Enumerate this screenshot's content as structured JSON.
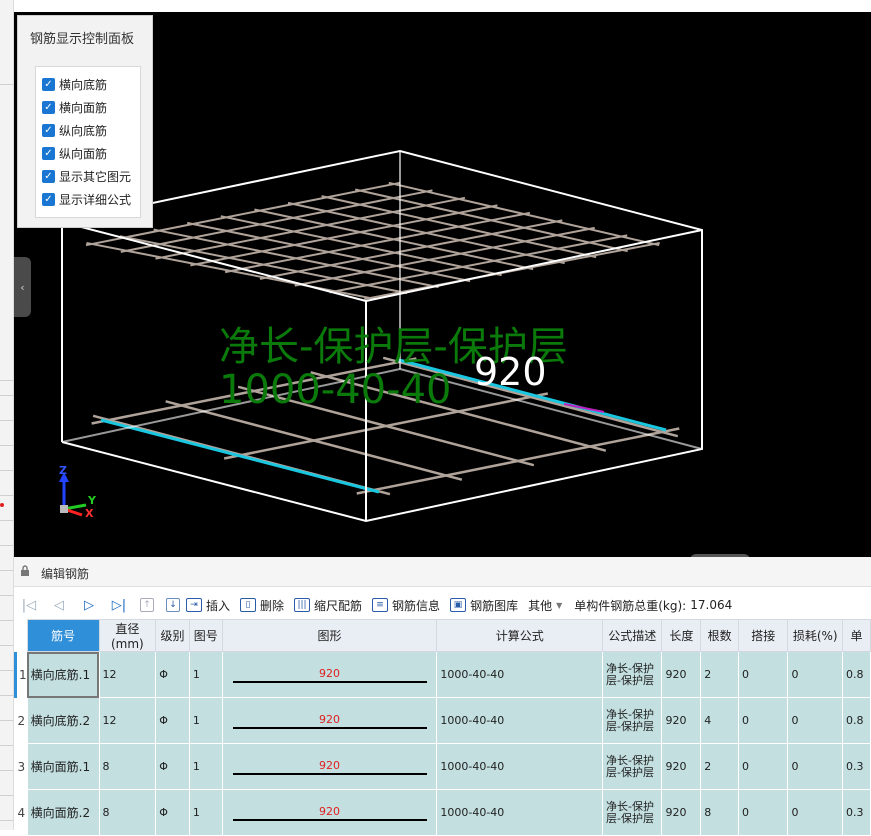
{
  "control_panel": {
    "title": "钢筋显示控制面板",
    "options": [
      {
        "label": "横向底筋",
        "checked": true
      },
      {
        "label": "横向面筋",
        "checked": true
      },
      {
        "label": "纵向底筋",
        "checked": true
      },
      {
        "label": "纵向面筋",
        "checked": true
      },
      {
        "label": "显示其它图元",
        "checked": true
      },
      {
        "label": "显示详细公式",
        "checked": true
      }
    ]
  },
  "viewport": {
    "formula_label": "净长-保护层-保护层",
    "formula_values": "1000-40-40",
    "length_label": "920",
    "axes": {
      "x": "X",
      "y": "Y",
      "z": "Z"
    },
    "colors": {
      "background": "#000000",
      "box_edges": "#ffffff",
      "rebar": "#b0a39a",
      "highlight": "#19c8e0",
      "formula": "#0a7a0a"
    }
  },
  "editor": {
    "title": "编辑钢筋",
    "toolbar": {
      "insert": "插入",
      "delete": "删除",
      "scale_rebar": "缩尺配筋",
      "rebar_info": "钢筋信息",
      "rebar_library": "钢筋图库",
      "other": "其他",
      "total_weight_label": "单构件钢筋总重(kg):",
      "total_weight_value": "17.064"
    },
    "columns": [
      "筋号",
      "直径(mm)",
      "级别",
      "图号",
      "图形",
      "计算公式",
      "公式描述",
      "长度",
      "根数",
      "搭接",
      "损耗(%)",
      "单"
    ],
    "rows": [
      {
        "num": "1",
        "name": "横向底筋.1",
        "diameter": "12",
        "grade": "Φ",
        "fig": "1",
        "shape": "920",
        "formula": "1000-40-40",
        "desc": "净长-保护层-保护层",
        "length": "920",
        "count": "2",
        "lap": "0",
        "loss": "0",
        "unit": "0.8"
      },
      {
        "num": "2",
        "name": "横向底筋.2",
        "diameter": "12",
        "grade": "Φ",
        "fig": "1",
        "shape": "920",
        "formula": "1000-40-40",
        "desc": "净长-保护层-保护层",
        "length": "920",
        "count": "4",
        "lap": "0",
        "loss": "0",
        "unit": "0.8"
      },
      {
        "num": "3",
        "name": "横向面筋.1",
        "diameter": "8",
        "grade": "Φ",
        "fig": "1",
        "shape": "920",
        "formula": "1000-40-40",
        "desc": "净长-保护层-保护层",
        "length": "920",
        "count": "2",
        "lap": "0",
        "loss": "0",
        "unit": "0.3"
      },
      {
        "num": "4",
        "name": "横向面筋.2",
        "diameter": "8",
        "grade": "Φ",
        "fig": "1",
        "shape": "920",
        "formula": "1000-40-40",
        "desc": "净长-保护层-保护层",
        "length": "920",
        "count": "8",
        "lap": "0",
        "loss": "0",
        "unit": "0.3"
      }
    ]
  }
}
